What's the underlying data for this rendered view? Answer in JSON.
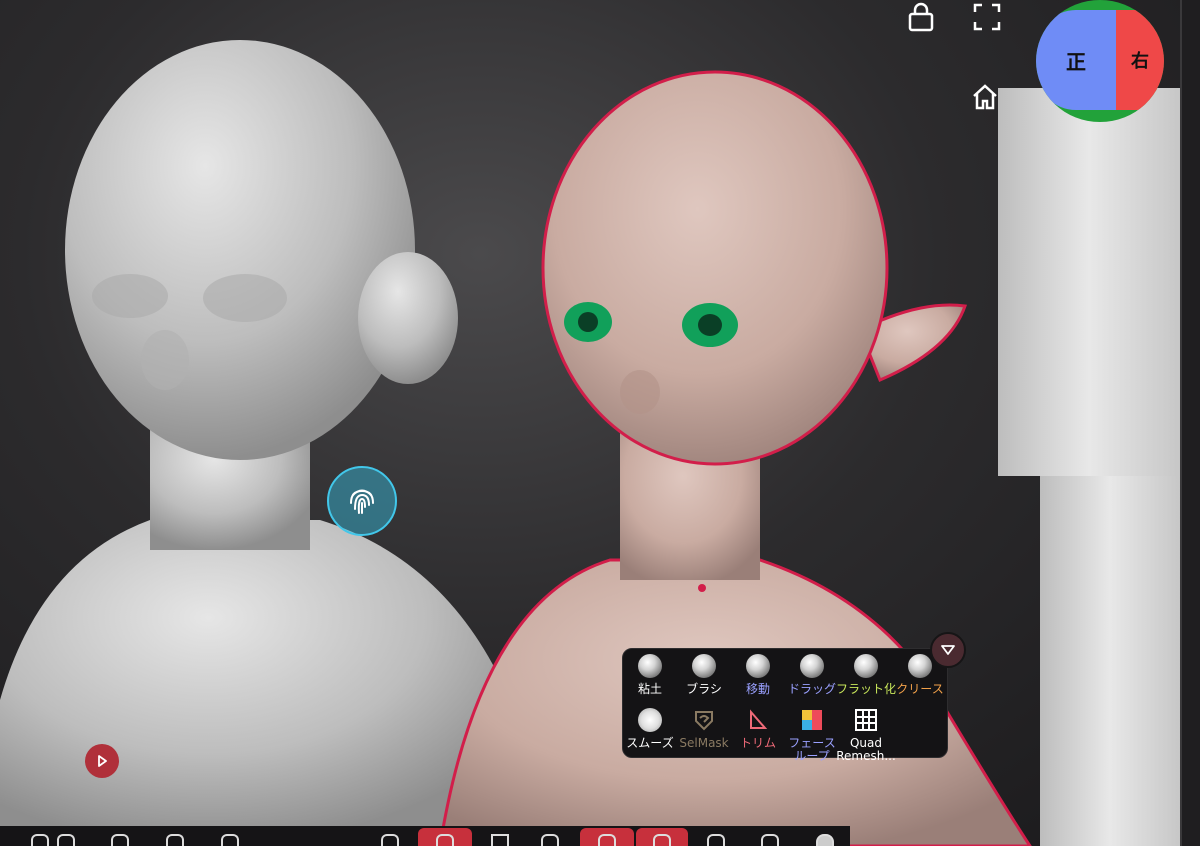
{
  "view_cube": {
    "front_label": "正",
    "right_label": "右"
  },
  "tools_popup": {
    "row1": [
      {
        "label": "粘土",
        "color": "#ffffff"
      },
      {
        "label": "ブラシ",
        "color": "#ffffff"
      },
      {
        "label": "移動",
        "color": "#9aa0ff"
      },
      {
        "label": "ドラッグ",
        "color": "#9aa0ff"
      },
      {
        "label": "フラット化",
        "color": "#c8e65a"
      },
      {
        "label": "クリース",
        "color": "#f2a14a"
      }
    ],
    "row2": [
      {
        "label": "スムーズ",
        "color": "#ffffff"
      },
      {
        "label": "SelMask",
        "color": "#8a7a62"
      },
      {
        "label": "トリム",
        "color": "#ee6a78"
      },
      {
        "label": "フェースループ",
        "color": "#9aa0ff"
      },
      {
        "label": "Quad Remesh...",
        "color": "#ffffff"
      }
    ]
  },
  "icons": [
    "lock-icon",
    "fullscreen-icon",
    "home-icon",
    "fingerprint-icon",
    "play-icon",
    "collapse-triangle-icon"
  ],
  "colors": {
    "selection_outline": "#d21e4a",
    "accent": "#c7303c",
    "fingerprint": "#42c7ea"
  }
}
